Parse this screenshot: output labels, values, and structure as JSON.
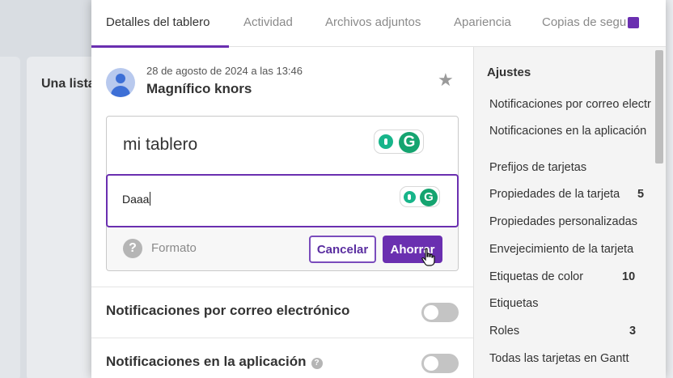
{
  "background": {
    "list_title": "Una lista"
  },
  "tabs": [
    {
      "label": "Detalles del tablero",
      "active": true
    },
    {
      "label": "Actividad"
    },
    {
      "label": "Archivos adjuntos"
    },
    {
      "label": "Apariencia"
    },
    {
      "label": "Copias de seguridad"
    }
  ],
  "header": {
    "date": "28 de agosto de 2024 a las 13:46",
    "author": "Magnífico knors",
    "star_icon": "star-icon"
  },
  "editor": {
    "board_name": "mi tablero",
    "description": "Daaa",
    "format_label": "Formato",
    "cancel_label": "Cancelar",
    "save_label": "Ahorrar",
    "grammarly_letter": "G"
  },
  "notifications": {
    "email_label": "Notificaciones por correo electrónico",
    "app_label": "Notificaciones en la aplicación",
    "help_glyph": "?"
  },
  "settings": {
    "title": "Ajustes",
    "items": [
      {
        "label": "Notificaciones por correo electrónico",
        "count": ""
      },
      {
        "label": "Notificaciones en la aplicación",
        "count": ""
      },
      {
        "label": "Prefijos de tarjetas",
        "count": ""
      },
      {
        "label": "Propiedades de la tarjeta",
        "count": "5"
      },
      {
        "label": "Propiedades personalizadas",
        "count": ""
      },
      {
        "label": "Envejecimiento de la tarjeta",
        "count": ""
      },
      {
        "label": "Etiquetas de color",
        "count": "10"
      },
      {
        "label": "Etiquetas",
        "count": ""
      },
      {
        "label": "Roles",
        "count": "3"
      },
      {
        "label": "Todas las tarjetas en Gantt",
        "count": ""
      }
    ]
  },
  "colors": {
    "accent": "#6a2fb0",
    "grammarly": "#15a470"
  }
}
